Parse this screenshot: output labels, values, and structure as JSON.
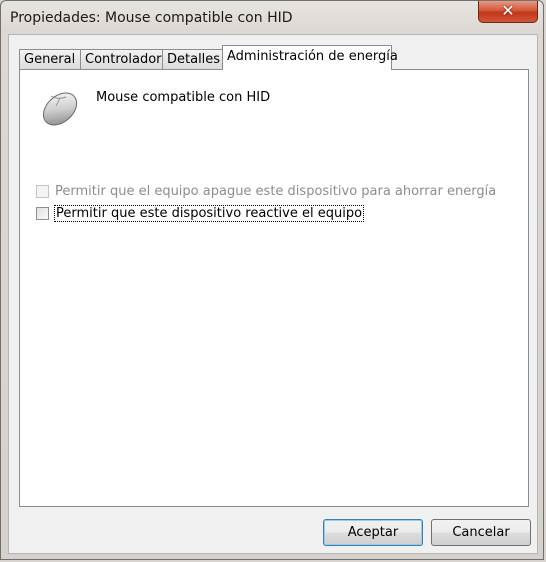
{
  "window": {
    "title": "Propiedades: Mouse compatible con HID",
    "close_symbol": "✕"
  },
  "tabs": [
    {
      "label": "General",
      "active": false
    },
    {
      "label": "Controlador",
      "active": false
    },
    {
      "label": "Detalles",
      "active": false
    },
    {
      "label": "Administración de energía",
      "active": true
    }
  ],
  "device": {
    "name": "Mouse compatible con HID",
    "icon": "mouse-icon"
  },
  "options": [
    {
      "label": "Permitir que el equipo apague este dispositivo para ahorrar energía",
      "checked": false,
      "enabled": false
    },
    {
      "label": "Permitir que este dispositivo reactive el equipo",
      "checked": false,
      "enabled": true
    }
  ],
  "buttons": {
    "ok": "Aceptar",
    "cancel": "Cancelar"
  }
}
